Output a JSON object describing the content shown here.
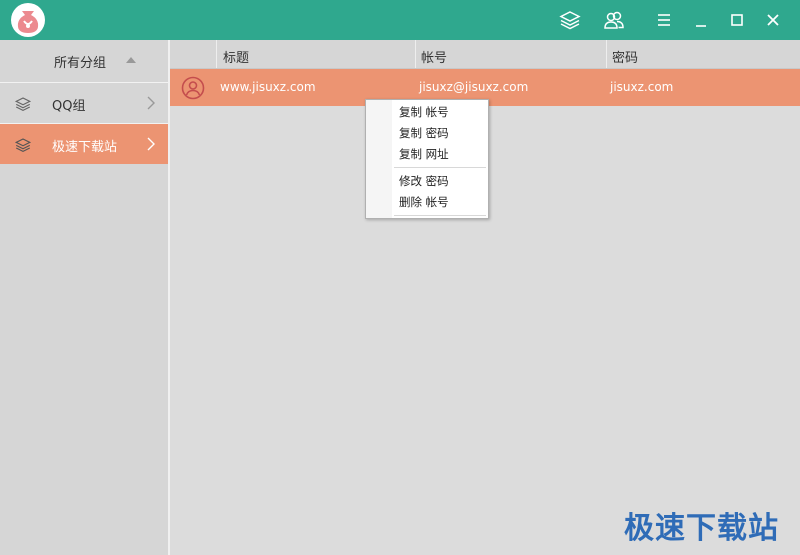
{
  "app": {
    "accent": "#2fa88e",
    "highlight": "#ec9472"
  },
  "titlebar": {
    "icons": [
      "logo-icon",
      "layers-icon",
      "users-icon",
      "menu-icon",
      "minimize-icon",
      "maximize-icon",
      "close-icon"
    ]
  },
  "sidebar": {
    "header": "所有分组",
    "items": [
      {
        "label": "QQ组",
        "icon": "layers-icon",
        "active": false
      },
      {
        "label": "极速下载站",
        "icon": "layers-icon",
        "active": true
      }
    ]
  },
  "table": {
    "columns": [
      "标题",
      "帐号",
      "密码"
    ],
    "rows": [
      {
        "title": "www.jisuxz.com",
        "account": "jisuxz@jisuxz.com",
        "password": "jisuxz.com"
      }
    ]
  },
  "context_menu": {
    "items": [
      "复制 帐号",
      "复制 密码",
      "复制 网址",
      "修改 密码",
      "删除 帐号"
    ]
  },
  "watermark": "极速下载站"
}
